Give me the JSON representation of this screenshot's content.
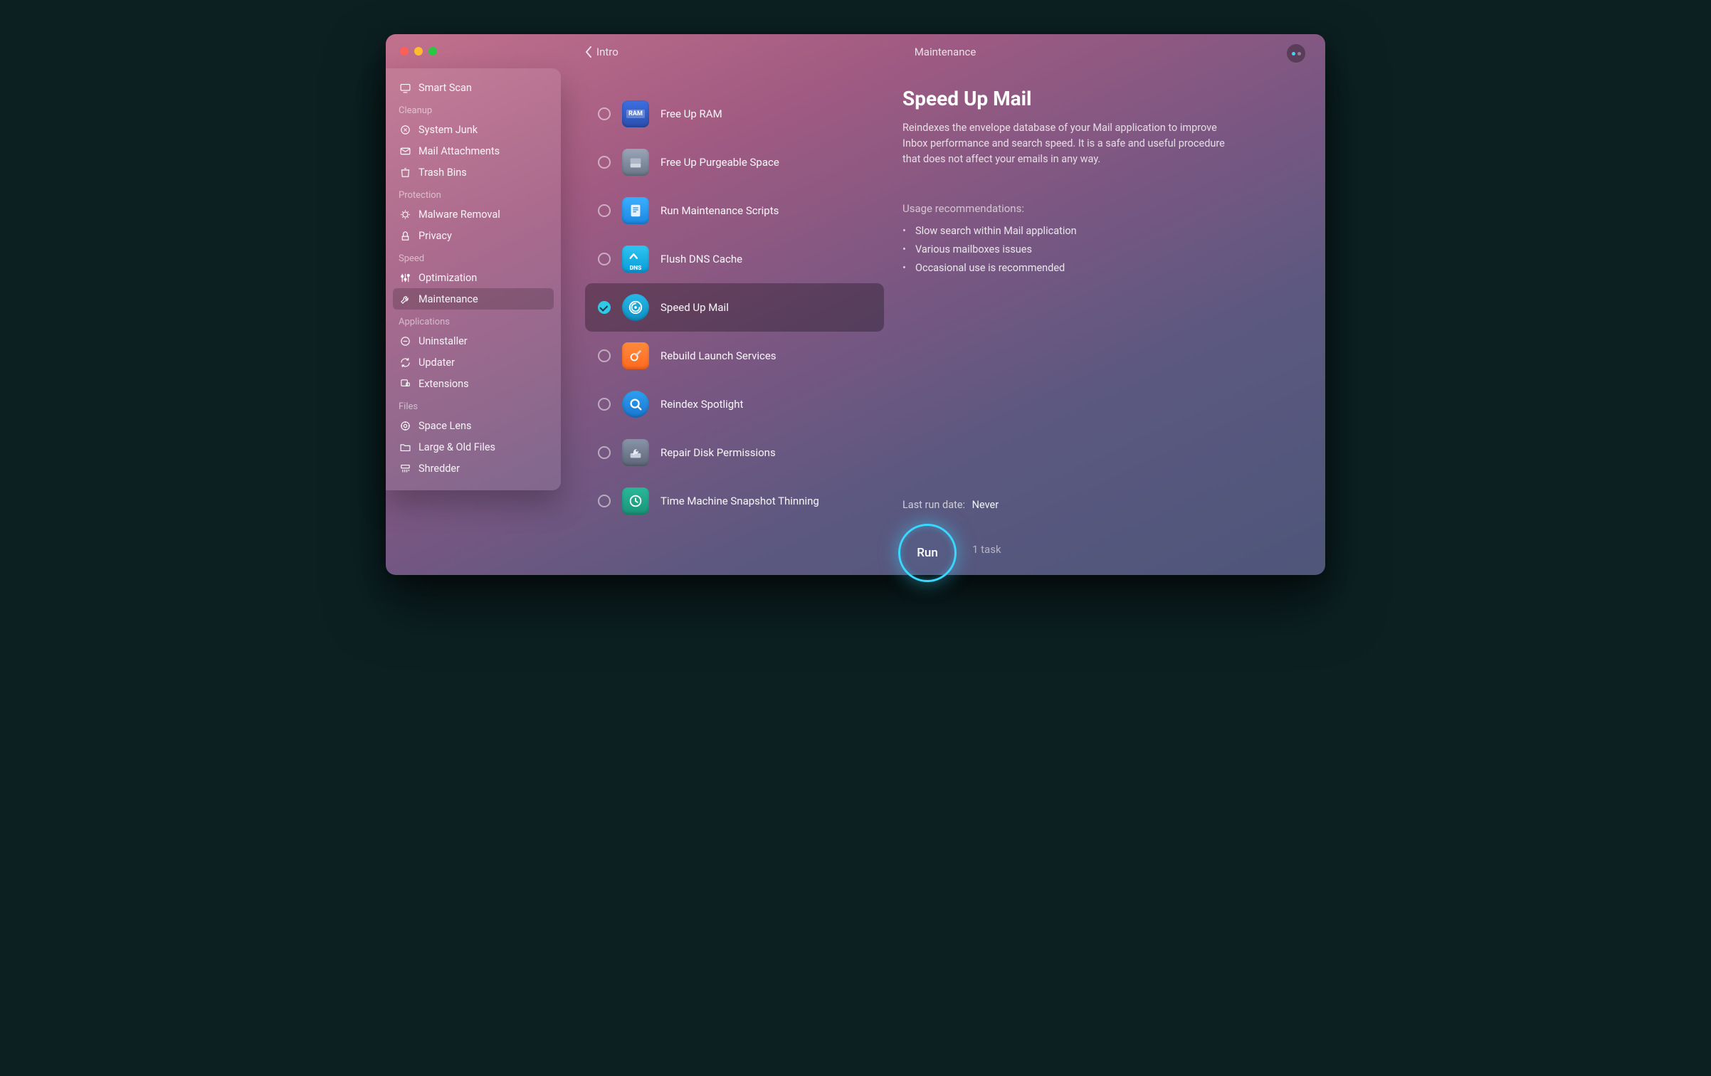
{
  "window": {
    "back_label": "Intro",
    "header_title": "Maintenance"
  },
  "sidebar": {
    "top_item": "Smart Scan",
    "sections": [
      {
        "title": "Cleanup",
        "items": [
          "System Junk",
          "Mail Attachments",
          "Trash Bins"
        ]
      },
      {
        "title": "Protection",
        "items": [
          "Malware Removal",
          "Privacy"
        ]
      },
      {
        "title": "Speed",
        "items": [
          "Optimization",
          "Maintenance"
        ]
      },
      {
        "title": "Applications",
        "items": [
          "Uninstaller",
          "Updater",
          "Extensions"
        ]
      },
      {
        "title": "Files",
        "items": [
          "Space Lens",
          "Large & Old Files",
          "Shredder"
        ]
      }
    ],
    "active": "Maintenance"
  },
  "tasks": [
    {
      "label": "Free Up RAM",
      "icon": "ram",
      "checked": false
    },
    {
      "label": "Free Up Purgeable Space",
      "icon": "purge",
      "checked": false
    },
    {
      "label": "Run Maintenance Scripts",
      "icon": "scripts",
      "checked": false
    },
    {
      "label": "Flush DNS Cache",
      "icon": "dns",
      "checked": false
    },
    {
      "label": "Speed Up Mail",
      "icon": "mail",
      "checked": true,
      "selected": true
    },
    {
      "label": "Rebuild Launch Services",
      "icon": "launch",
      "checked": false
    },
    {
      "label": "Reindex Spotlight",
      "icon": "spot",
      "checked": false
    },
    {
      "label": "Repair Disk Permissions",
      "icon": "disk",
      "checked": false
    },
    {
      "label": "Time Machine Snapshot Thinning",
      "icon": "tm",
      "checked": false
    }
  ],
  "detail": {
    "title": "Speed Up Mail",
    "description": "Reindexes the envelope database of your Mail application to improve Inbox performance and search speed. It is a safe and useful procedure that does not affect your emails in any way.",
    "usage_heading": "Usage recommendations:",
    "usage": [
      "Slow search within Mail application",
      "Various mailboxes issues",
      "Occasional use is recommended"
    ],
    "last_run_label": "Last run date:",
    "last_run_value": "Never",
    "run_label": "Run",
    "task_count": "1 task"
  }
}
